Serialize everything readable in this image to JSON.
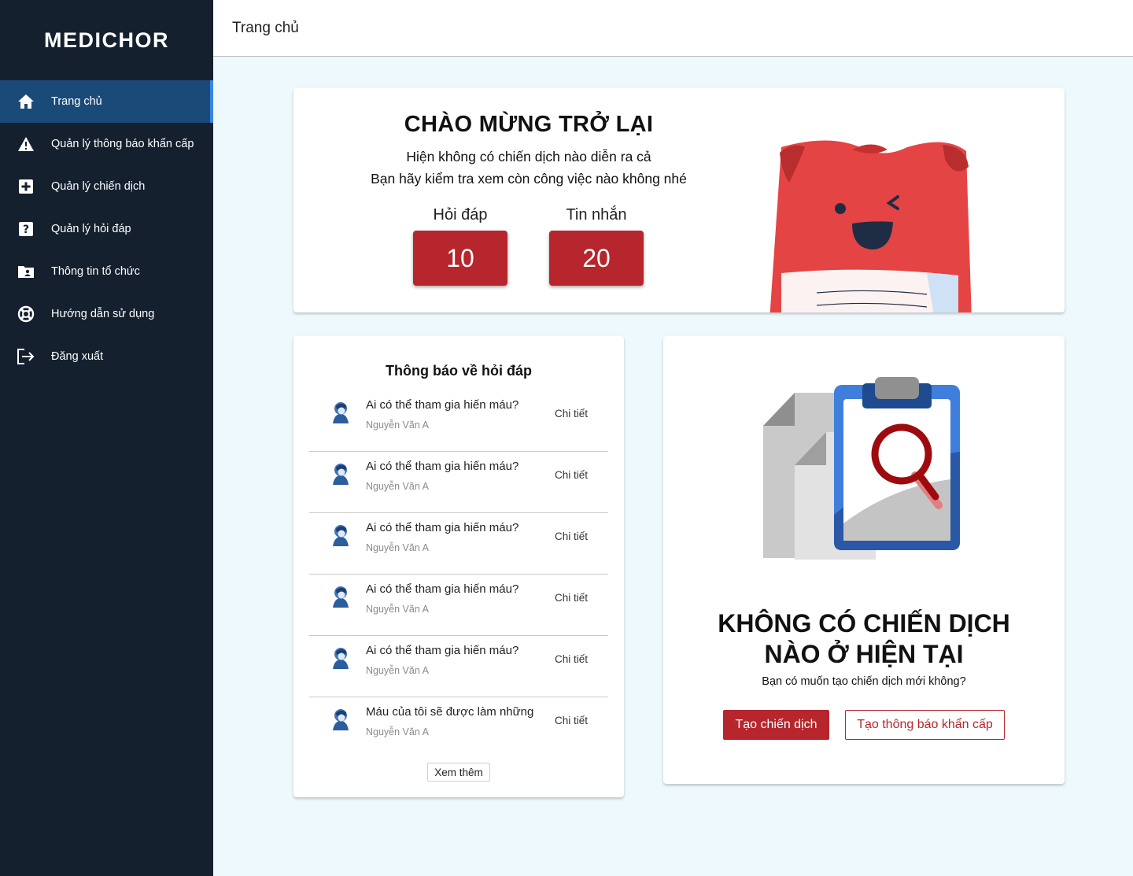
{
  "app": {
    "logo": "MEDICHOR"
  },
  "sidebar": {
    "items": [
      {
        "label": "Trang chủ",
        "icon": "home-icon",
        "active": true
      },
      {
        "label": "Quản lý thông báo khẩn cấp",
        "icon": "warning-icon"
      },
      {
        "label": "Quản lý chiến dịch",
        "icon": "medical-plus-icon"
      },
      {
        "label": "Quản lý hỏi đáp",
        "icon": "question-icon"
      },
      {
        "label": "Thông tin tổ chức",
        "icon": "organization-folder-icon"
      },
      {
        "label": "Hướng dẫn sử dụng",
        "icon": "lifebuoy-icon"
      },
      {
        "label": "Đăng xuất",
        "icon": "logout-icon"
      }
    ]
  },
  "header": {
    "title": "Trang chủ"
  },
  "welcome": {
    "title": "CHÀO MỪNG TRỞ LẠI",
    "line1": "Hiện không có chiến dịch nào diễn ra cả",
    "line2": "Bạn hãy kiểm tra xem còn công việc nào không nhé",
    "stats": [
      {
        "label": "Hỏi đáp",
        "value": "10"
      },
      {
        "label": "Tin nhắn",
        "value": "20"
      }
    ]
  },
  "qa": {
    "title": "Thông báo về hỏi đáp",
    "detail_label": "Chi tiết",
    "more_label": "Xem thêm",
    "items": [
      {
        "question": "Ai có thể tham gia hiến máu?",
        "author": "Nguyễn Văn A"
      },
      {
        "question": "Ai có thể tham gia hiến máu?",
        "author": "Nguyễn Văn A"
      },
      {
        "question": "Ai có thể tham gia hiến máu?",
        "author": "Nguyễn Văn A"
      },
      {
        "question": "Ai có thể tham gia hiến máu?",
        "author": "Nguyễn Văn A"
      },
      {
        "question": "Ai có thể tham gia hiến máu?",
        "author": "Nguyễn Văn A"
      },
      {
        "question": "Máu của tôi sẽ được làm những",
        "author": "Nguyễn Văn A"
      }
    ]
  },
  "campaign": {
    "title_line1": "KHÔNG CÓ CHIẾN DỊCH",
    "title_line2": "NÀO Ở HIỆN TẠI",
    "subtitle": "Bạn có muốn tạo chiến dịch mới không?",
    "create_label": "Tạo chiến dịch",
    "emergency_label": "Tạo thông báo khẩn cấp"
  },
  "colors": {
    "sidebar_bg": "#14202e",
    "active_bg": "#1a4a78",
    "accent_red": "#b6262c",
    "page_bg": "#eef9fd"
  }
}
